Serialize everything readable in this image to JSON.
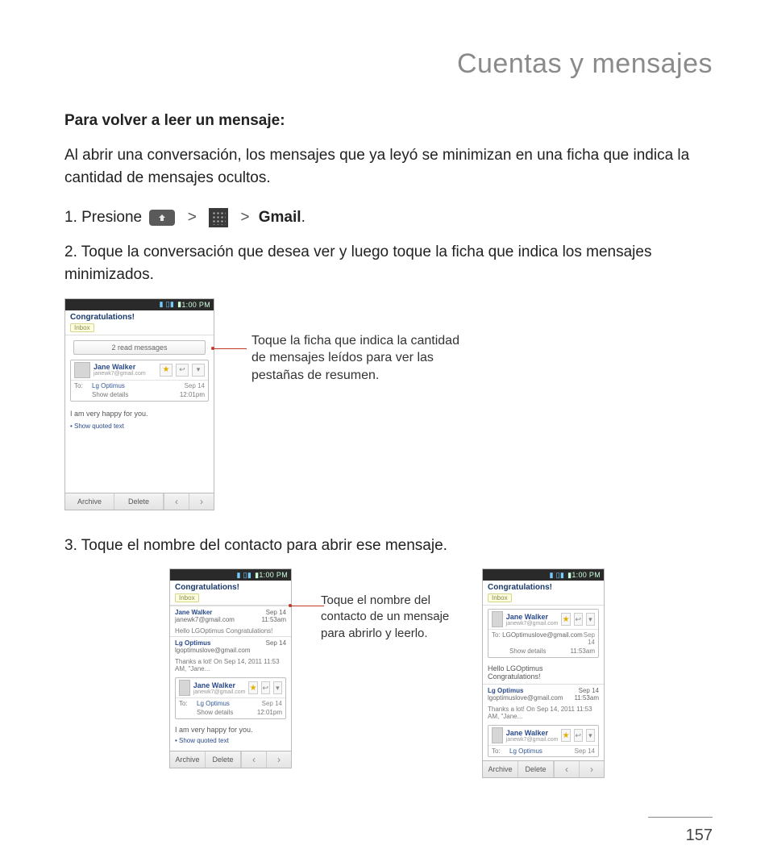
{
  "title": "Cuentas y mensajes",
  "subtitle": "Para volver a leer un mensaje:",
  "intro": "Al abrir una conversación, los mensajes que ya leyó se minimizan en una ficha que indica la cantidad de mensajes ocultos.",
  "step1_a": "1. Presione ",
  "step1_b": "Gmail",
  "step1_dot": ".",
  "gt": ">",
  "step2": "2. Toque la conversación que desea ver y luego toque la ficha que indica los mensajes minimizados.",
  "callout1": "Toque la ficha que indica la cantidad de mensajes leídos para ver las pestañas de resumen.",
  "step3": "3. Toque el nombre del contacto para abrir ese mensaje.",
  "callout2": "Toque el nombre del contacto de un mensaje para abrirlo y leerlo.",
  "page_no": "157",
  "phone": {
    "time": "1:00 PM",
    "conv_title": "Congratulations!",
    "inbox": "Inbox",
    "read_tab": "2 read messages",
    "name1": "Jane Walker",
    "email1": "janewk7@gmail.com",
    "name2": "Lg Optimus",
    "email2": "lgoptimuslove@gmail.com",
    "to_label": "To:",
    "to_value": "Lg Optimus",
    "date": "Sep 14",
    "time2": "12:01pm",
    "time3": "11:53am",
    "show_details": "Show details",
    "body1": "I am very happy for you.",
    "quoted": "• Show quoted text",
    "archive": "Archive",
    "delete": "Delete",
    "hello_line": "Hello LGOptimus Congratulations!",
    "thanks_line": "Thanks a lot! On Sep 14, 2011 11:53 AM, \"Jane...",
    "hello2a": "Hello LGOptimus",
    "hello2b": "Congratulations!",
    "to_long": "LGOptimuslove@gmail.com"
  }
}
